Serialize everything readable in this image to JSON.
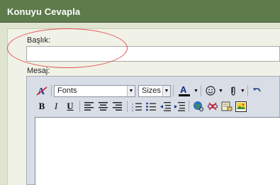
{
  "window": {
    "title": "Konuyu Cevapla"
  },
  "form": {
    "subject_label": "Başlık:",
    "subject_value": "",
    "message_label": "Mesaj:"
  },
  "editor": {
    "font_select": "Fonts",
    "size_select": "Sizes",
    "icons": [
      "remove-format-icon",
      "font-color-icon",
      "smiley-icon",
      "attachment-icon",
      "undo-icon",
      "bold-icon",
      "italic-icon",
      "underline-icon",
      "align-left-icon",
      "align-center-icon",
      "align-right-icon",
      "ordered-list-icon",
      "unordered-list-icon",
      "outdent-icon",
      "indent-icon",
      "link-icon",
      "unlink-icon",
      "email-icon",
      "image-icon"
    ]
  },
  "colors": {
    "titlebar": "#5d7b4b",
    "highlight_ellipse": "#e05050",
    "font_color_bar": "#000000"
  }
}
